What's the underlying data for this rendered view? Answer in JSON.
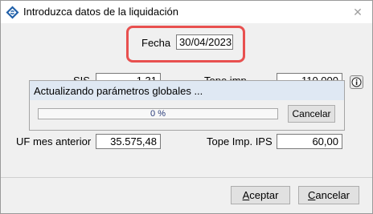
{
  "window": {
    "title": "Introduzca datos de la liquidación",
    "close_glyph": "✕"
  },
  "form": {
    "fecha_label": "Fecha",
    "fecha_value": "30/04/2023",
    "sis_label": "SIS",
    "sis_value": "1,31",
    "tope_label": "Tope imp.",
    "tope_value": "110,000",
    "uf_label": "UF mes anterior",
    "uf_value": "35.575,48",
    "tope_ips_label": "Tope Imp. IPS",
    "tope_ips_value": "60,00"
  },
  "progress": {
    "title": "Actualizando parámetros globales ...",
    "percent_text": "0 %",
    "percent": 0,
    "cancel_label": "Cancelar"
  },
  "buttons": {
    "accept_accel": "A",
    "accept_rest": "ceptar",
    "cancel_accel": "C",
    "cancel_rest": "ancelar"
  },
  "colors": {
    "highlight": "#e8504f",
    "progress_fill": "#06b025",
    "app_icon": "#1f5fa8"
  },
  "icons": {
    "app": "app-logo-icon",
    "info": "info-icon",
    "close": "close-icon"
  }
}
